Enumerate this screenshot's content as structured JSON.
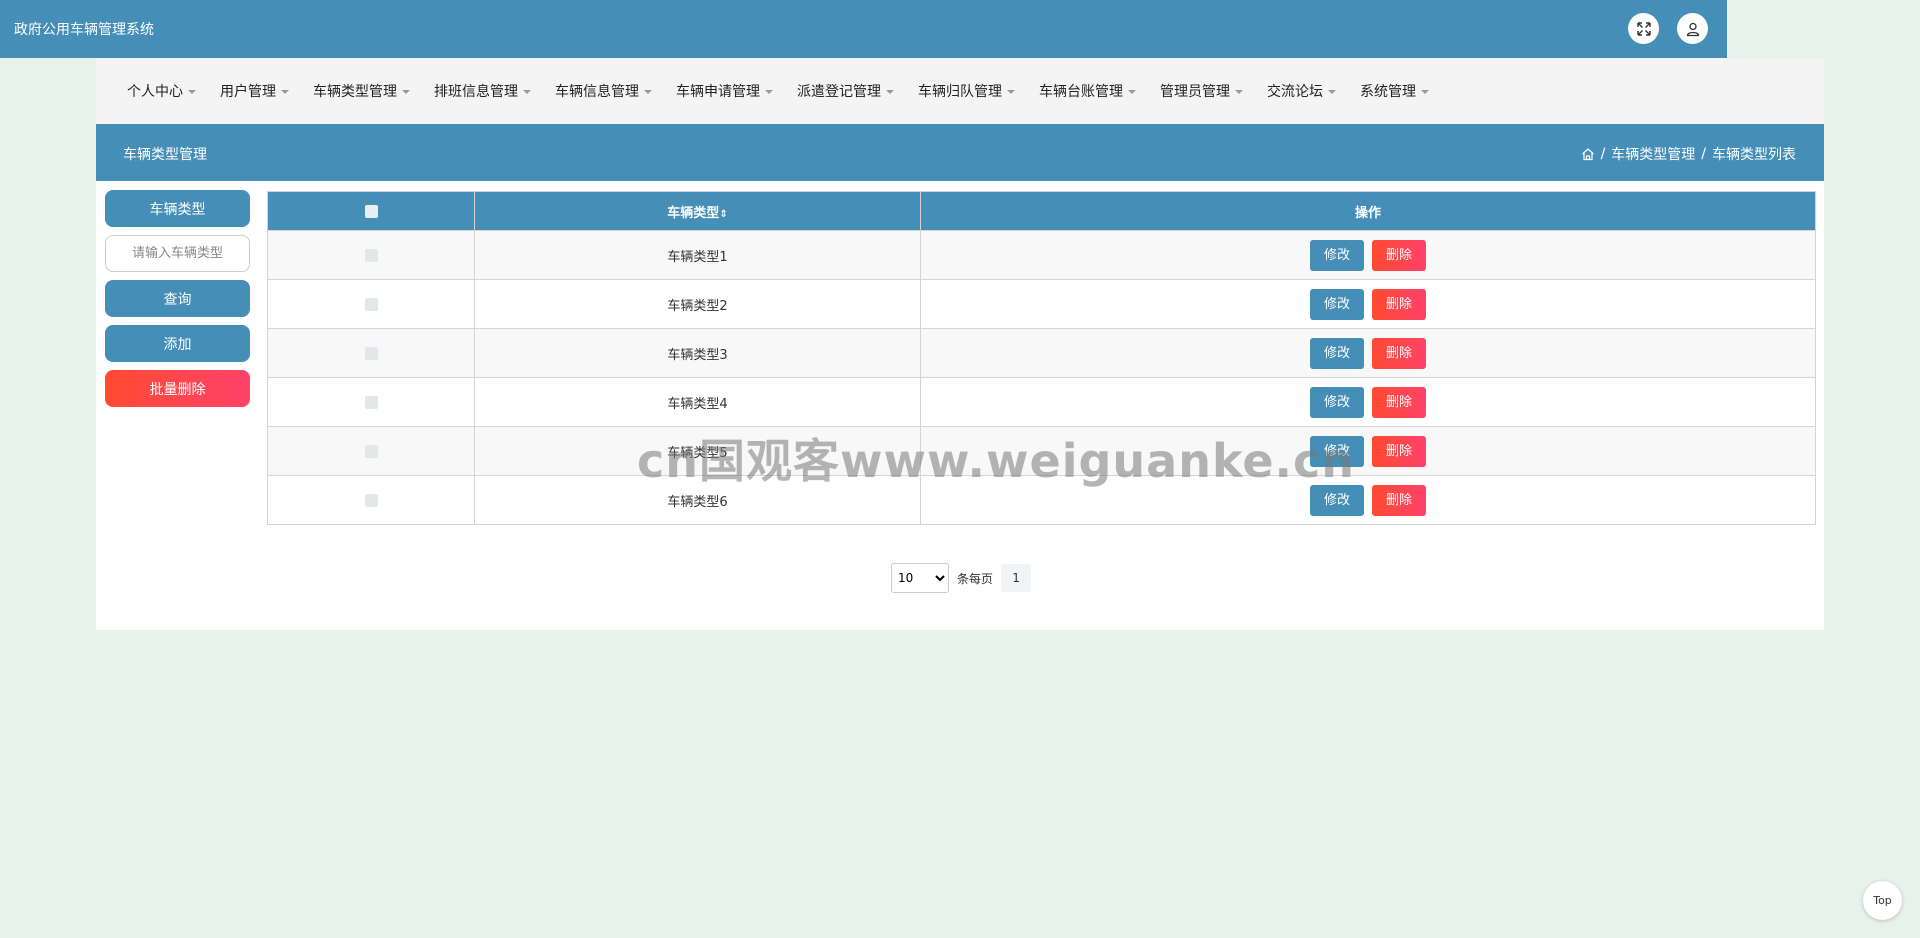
{
  "app": {
    "title": "政府公用车辆管理系统"
  },
  "topbar": {
    "fullscreen_icon": "expand-icon",
    "user_icon": "user-icon"
  },
  "nav": {
    "items": [
      {
        "label": "个人中心"
      },
      {
        "label": "用户管理"
      },
      {
        "label": "车辆类型管理"
      },
      {
        "label": "排班信息管理"
      },
      {
        "label": "车辆信息管理"
      },
      {
        "label": "车辆申请管理"
      },
      {
        "label": "派遣登记管理"
      },
      {
        "label": "车辆归队管理"
      },
      {
        "label": "车辆台账管理"
      },
      {
        "label": "管理员管理"
      },
      {
        "label": "交流论坛"
      },
      {
        "label": "系统管理"
      }
    ]
  },
  "page_header": {
    "title": "车辆类型管理",
    "breadcrumb": {
      "home_icon": "home-icon",
      "level1": "车辆类型管理",
      "level2": "车辆类型列表",
      "sep": "/"
    }
  },
  "sidebar": {
    "field_label": "车辆类型",
    "search_placeholder": "请输入车辆类型",
    "query_label": "查询",
    "add_label": "添加",
    "batch_delete_label": "批量删除"
  },
  "table": {
    "columns": {
      "type": "车辆类型",
      "sort_glyph": "⇕",
      "action": "操作"
    },
    "edit_label": "修改",
    "delete_label": "删除",
    "rows": [
      {
        "type": "车辆类型1"
      },
      {
        "type": "车辆类型2"
      },
      {
        "type": "车辆类型3"
      },
      {
        "type": "车辆类型4"
      },
      {
        "type": "车辆类型5"
      },
      {
        "type": "车辆类型6"
      }
    ]
  },
  "pagination": {
    "page_size": "10",
    "page_size_options": [
      "10"
    ],
    "per_page_label": "条每页",
    "current_page": "1"
  },
  "watermark": "cn国观客www.weiguanke.cn",
  "back_to_top": "Top",
  "colors": {
    "primary": "#448eb8",
    "danger": "#ff4a32",
    "background": "#e6f2ec"
  }
}
